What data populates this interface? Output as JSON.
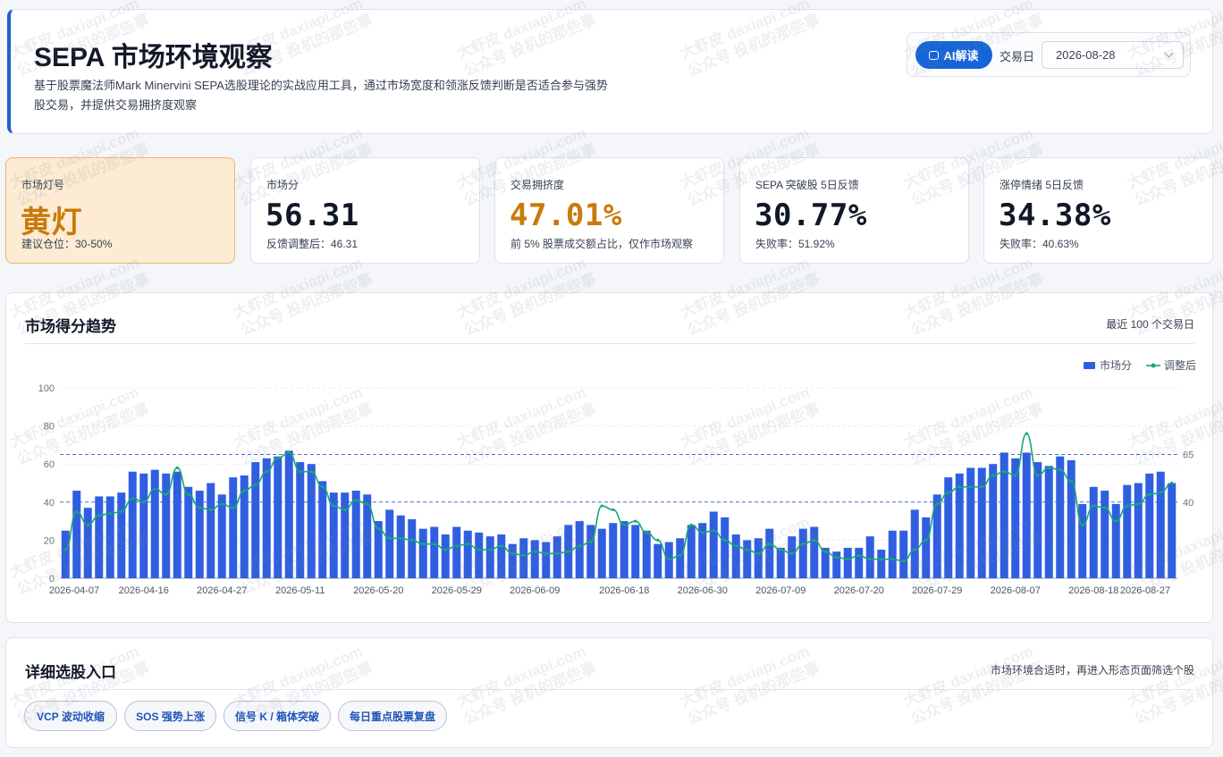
{
  "header": {
    "title": "SEPA 市场环境观察",
    "description": "基于股票魔法师Mark Minervini SEPA选股理论的实战应用工具，通过市场宽度和领涨反馈判断是否适合参与强势股交易，并提供交易拥挤度观察",
    "ai_button_label": "AI解读",
    "trade_date_label": "交易日",
    "trade_date_value": "2026-08-28"
  },
  "stats": [
    {
      "title": "市场灯号",
      "value": "黄灯",
      "sub": "建议仓位：30-50%",
      "color": "#c97a0a"
    },
    {
      "title": "市场分",
      "value": "56.31",
      "sub": "反馈调整后：46.31"
    },
    {
      "title": "交易拥挤度",
      "value": "47.01%",
      "sub": "前 5% 股票成交额占比，仅作市场观察",
      "color": "#c97a0a"
    },
    {
      "title": "SEPA 突破股 5日反馈",
      "value": "30.77%",
      "sub": "失败率：51.92%"
    },
    {
      "title": "涨停情绪 5日反馈",
      "value": "34.38%",
      "sub": "失败率：40.63%"
    }
  ],
  "chart_section": {
    "title": "市场得分趋势",
    "note": "最近 100 个交易日"
  },
  "chart_data": {
    "type": "bar",
    "legend": [
      {
        "name": "市场分",
        "color": "#2f5fe0"
      },
      {
        "name": "调整后",
        "color": "#17a870"
      }
    ],
    "legend_position": "top-right",
    "ylim": [
      0,
      100
    ],
    "yticks": [
      0,
      20,
      40,
      60,
      80,
      100
    ],
    "reference_lines": [
      65,
      40
    ],
    "xtick_labels": [
      "2026-04-07",
      "2026-04-16",
      "2026-04-27",
      "2026-05-11",
      "2026-05-20",
      "2026-05-29",
      "2026-06-09",
      "2026-06-18",
      "2026-06-30",
      "2026-07-09",
      "2026-07-20",
      "2026-07-29",
      "2026-08-07",
      "2026-08-18",
      "2026-08-27"
    ],
    "series": [
      {
        "name": "市场分",
        "values": [
          25,
          46,
          37,
          43,
          43,
          45,
          56,
          55,
          57,
          55,
          56,
          48,
          46,
          50,
          44,
          53,
          54,
          61,
          63,
          64,
          67,
          61,
          60,
          51,
          45,
          45,
          46,
          44,
          30,
          36,
          33,
          31,
          26,
          27,
          23,
          27,
          25,
          24,
          22,
          23,
          18,
          21,
          20,
          19,
          22,
          28,
          30,
          28,
          26,
          29,
          30,
          28,
          25,
          18,
          19,
          21,
          28,
          29,
          35,
          32,
          23,
          20,
          21,
          26,
          16,
          22,
          26,
          27,
          16,
          14,
          16,
          16,
          22,
          15,
          25,
          25,
          36,
          32,
          44,
          53,
          55,
          58,
          58,
          60,
          66,
          63,
          66,
          61,
          59,
          64,
          62,
          39,
          48,
          46,
          39,
          49,
          50,
          55,
          56,
          50
        ]
      },
      {
        "name": "调整后",
        "values": [
          15,
          35,
          28,
          33,
          34,
          35,
          42,
          40,
          47,
          44,
          58,
          44,
          37,
          36,
          39,
          37,
          46,
          49,
          56,
          63,
          66,
          56,
          56,
          48,
          38,
          36,
          41,
          39,
          26,
          21,
          21,
          20,
          18,
          18,
          15,
          17,
          18,
          15,
          15,
          17,
          13,
          12,
          14,
          13,
          13,
          14,
          17,
          19,
          38,
          36,
          28,
          30,
          24,
          20,
          10,
          12,
          28,
          24,
          25,
          20,
          17,
          15,
          13,
          18,
          15,
          13,
          18,
          20,
          14,
          11,
          10,
          12,
          10,
          10,
          10,
          9,
          15,
          20,
          39,
          45,
          48,
          48,
          48,
          54,
          56,
          54,
          76,
          54,
          58,
          57,
          51,
          28,
          38,
          37,
          30,
          38,
          39,
          44,
          45,
          50
        ]
      }
    ]
  },
  "entry_section": {
    "title": "详细选股入口",
    "note": "市场环境合适时，再进入形态页面筛选个股",
    "buttons": [
      "VCP 波动收缩",
      "SOS 强势上涨",
      "信号 K / 箱体突破",
      "每日重点股票复盘"
    ]
  }
}
